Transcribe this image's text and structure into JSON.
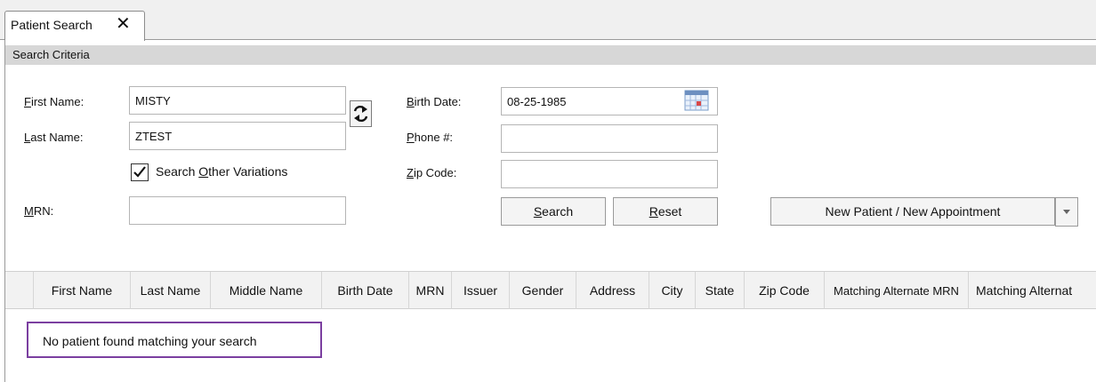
{
  "tab": {
    "label": "Patient Search",
    "close_glyph": "✕"
  },
  "criteria": {
    "header": "Search Criteria",
    "first_name": {
      "label": "First Name:",
      "value": "MISTY"
    },
    "last_name": {
      "label": "Last Name:",
      "value": "ZTEST"
    },
    "search_variations": {
      "label": "Search Other Variations",
      "checked": true
    },
    "mrn": {
      "label": "MRN:",
      "value": ""
    },
    "birth_date": {
      "label": "Birth Date:",
      "value": "08-25-1985"
    },
    "phone": {
      "label": "Phone #:",
      "value": ""
    },
    "zip_code": {
      "label": "Zip Code:",
      "value": ""
    }
  },
  "buttons": {
    "search": "Search",
    "reset": "Reset",
    "new_patient": "New Patient / New Appointment"
  },
  "results": {
    "columns": [
      "First Name",
      "Last Name",
      "Middle Name",
      "Birth Date",
      "MRN",
      "Issuer",
      "Gender",
      "Address",
      "City",
      "State",
      "Zip Code",
      "Matching Alternate MRN",
      "Matching Alternat"
    ],
    "empty_message": "No patient found matching your search"
  },
  "colors": {
    "highlight_border": "#7b3fa0",
    "header_bg": "#d7d7d7"
  },
  "icons": {
    "swap": "swap-arrows-icon",
    "calendar": "calendar-icon",
    "dropdown": "chevron-down-icon",
    "check": "checkmark-icon"
  }
}
